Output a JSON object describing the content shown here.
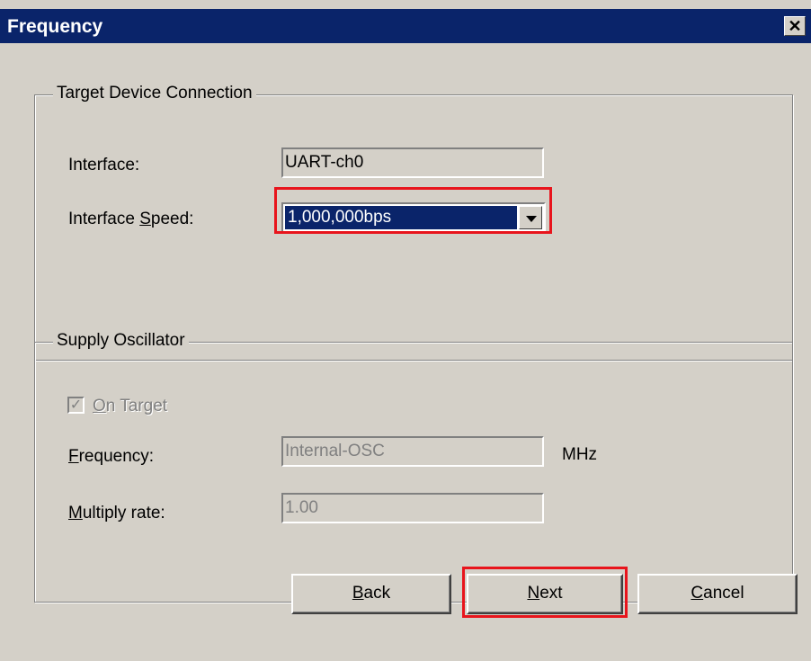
{
  "dialog": {
    "title": "Frequency",
    "close_glyph": "✕"
  },
  "target_group": {
    "legend": "Target Device Connection",
    "interface_label": "Interface:",
    "interface_value": "UART-ch0",
    "speed_label_pre": "Interface ",
    "speed_label_mnemonic": "S",
    "speed_label_post": "peed:",
    "speed_value": "1,000,000bps"
  },
  "oscillator_group": {
    "legend": "Supply Oscillator",
    "on_target_mnemonic": "O",
    "on_target_rest": "n Target",
    "on_target_checked": true,
    "frequency_mnemonic": "F",
    "frequency_rest": "requency:",
    "frequency_value": "Internal-OSC",
    "frequency_unit": "MHz",
    "multiply_mnemonic": "M",
    "multiply_rest": "ultiply rate:",
    "multiply_value": "1.00"
  },
  "buttons": {
    "back_mnemonic": "B",
    "back_rest": "ack",
    "next_mnemonic": "N",
    "next_rest": "ext",
    "cancel_mnemonic": "C",
    "cancel_rest": "ancel"
  },
  "colors": {
    "titlebar": "#0a246a",
    "highlight": "#e8141c",
    "face": "#d4d0c8"
  }
}
